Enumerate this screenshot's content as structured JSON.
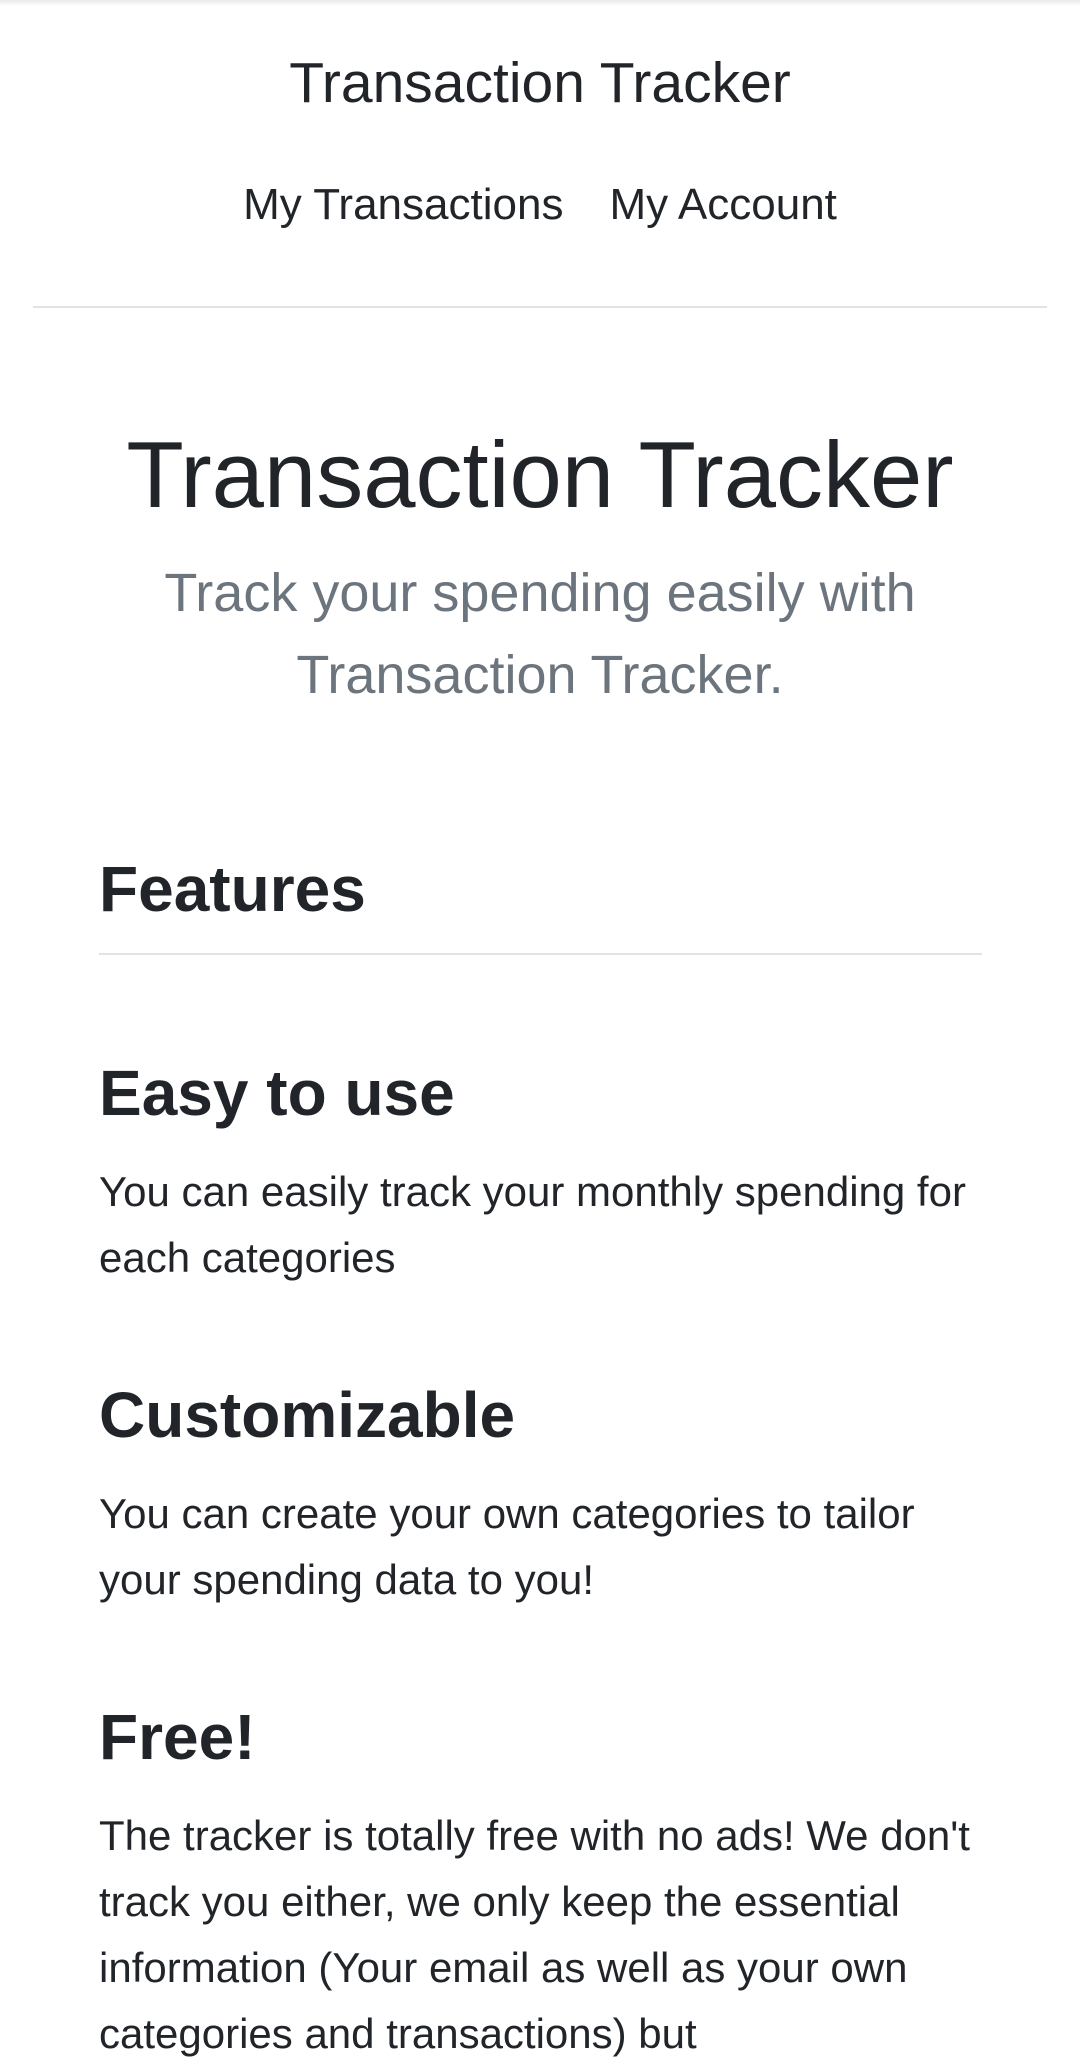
{
  "header": {
    "brand": "Transaction Tracker",
    "nav": {
      "transactions": "My Transactions",
      "account": "My Account"
    }
  },
  "hero": {
    "title": "Transaction Tracker",
    "lead": "Track your spending easily with Transaction Tracker."
  },
  "features": {
    "title": "Features",
    "items": [
      {
        "title": "Easy to use",
        "text": "You can easily track your monthly spending for each categories"
      },
      {
        "title": "Customizable",
        "text": "You can create your own categories to tailor your spending data to you!"
      },
      {
        "title": "Free!",
        "text": "The tracker is totally free with no ads! We don't track you either, we only keep the essential information (Your email as well as your own categories and transactions) but"
      }
    ]
  }
}
